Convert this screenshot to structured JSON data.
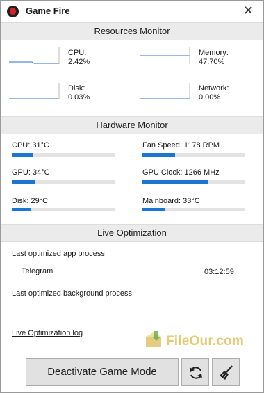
{
  "window": {
    "title": "Game Fire",
    "close_glyph": "✕",
    "logo_icon": "game-fire-logo-icon"
  },
  "resources": {
    "header": "Resources Monitor",
    "items": [
      {
        "label": "CPU:",
        "value": "2.42%"
      },
      {
        "label": "Memory:",
        "value": "47.70%"
      },
      {
        "label": "Disk:",
        "value": "0.03%"
      },
      {
        "label": "Network:",
        "value": "0.00%"
      }
    ]
  },
  "hardware": {
    "header": "Hardware Monitor",
    "items": [
      {
        "label": "CPU: 31°C",
        "level": 0.21
      },
      {
        "label": "Fan Speed: 1178 RPM",
        "level": 0.32
      },
      {
        "label": "GPU: 34°C",
        "level": 0.23
      },
      {
        "label": "GPU Clock: 1266 MHz",
        "level": 0.64
      },
      {
        "label": "Disk: 29°C",
        "level": 0.19
      },
      {
        "label": "Mainboard: 33°C",
        "level": 0.22
      }
    ],
    "bar_color": "#1976d2"
  },
  "live_optimization": {
    "header": "Live Optimization",
    "app_process_label": "Last optimized app process",
    "app_process_name": "Telegram",
    "app_process_time": "03:12:59",
    "background_process_label": "Last optimized background process",
    "log_link": "Live Optimization log"
  },
  "watermark": {
    "text": "FileOur.com"
  },
  "buttons": {
    "deactivate": "Deactivate Game Mode",
    "refresh_icon": "refresh-icon",
    "clean_icon": "broom-icon"
  }
}
